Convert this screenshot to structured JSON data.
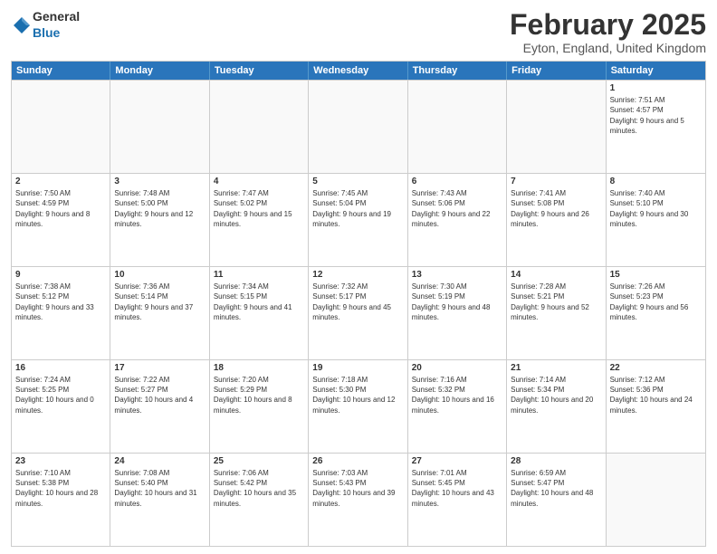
{
  "logo": {
    "general": "General",
    "blue": "Blue"
  },
  "title": "February 2025",
  "location": "Eyton, England, United Kingdom",
  "header_days": [
    "Sunday",
    "Monday",
    "Tuesday",
    "Wednesday",
    "Thursday",
    "Friday",
    "Saturday"
  ],
  "weeks": [
    [
      {
        "day": "",
        "info": ""
      },
      {
        "day": "",
        "info": ""
      },
      {
        "day": "",
        "info": ""
      },
      {
        "day": "",
        "info": ""
      },
      {
        "day": "",
        "info": ""
      },
      {
        "day": "",
        "info": ""
      },
      {
        "day": "1",
        "info": "Sunrise: 7:51 AM\nSunset: 4:57 PM\nDaylight: 9 hours and 5 minutes."
      }
    ],
    [
      {
        "day": "2",
        "info": "Sunrise: 7:50 AM\nSunset: 4:59 PM\nDaylight: 9 hours and 8 minutes."
      },
      {
        "day": "3",
        "info": "Sunrise: 7:48 AM\nSunset: 5:00 PM\nDaylight: 9 hours and 12 minutes."
      },
      {
        "day": "4",
        "info": "Sunrise: 7:47 AM\nSunset: 5:02 PM\nDaylight: 9 hours and 15 minutes."
      },
      {
        "day": "5",
        "info": "Sunrise: 7:45 AM\nSunset: 5:04 PM\nDaylight: 9 hours and 19 minutes."
      },
      {
        "day": "6",
        "info": "Sunrise: 7:43 AM\nSunset: 5:06 PM\nDaylight: 9 hours and 22 minutes."
      },
      {
        "day": "7",
        "info": "Sunrise: 7:41 AM\nSunset: 5:08 PM\nDaylight: 9 hours and 26 minutes."
      },
      {
        "day": "8",
        "info": "Sunrise: 7:40 AM\nSunset: 5:10 PM\nDaylight: 9 hours and 30 minutes."
      }
    ],
    [
      {
        "day": "9",
        "info": "Sunrise: 7:38 AM\nSunset: 5:12 PM\nDaylight: 9 hours and 33 minutes."
      },
      {
        "day": "10",
        "info": "Sunrise: 7:36 AM\nSunset: 5:14 PM\nDaylight: 9 hours and 37 minutes."
      },
      {
        "day": "11",
        "info": "Sunrise: 7:34 AM\nSunset: 5:15 PM\nDaylight: 9 hours and 41 minutes."
      },
      {
        "day": "12",
        "info": "Sunrise: 7:32 AM\nSunset: 5:17 PM\nDaylight: 9 hours and 45 minutes."
      },
      {
        "day": "13",
        "info": "Sunrise: 7:30 AM\nSunset: 5:19 PM\nDaylight: 9 hours and 48 minutes."
      },
      {
        "day": "14",
        "info": "Sunrise: 7:28 AM\nSunset: 5:21 PM\nDaylight: 9 hours and 52 minutes."
      },
      {
        "day": "15",
        "info": "Sunrise: 7:26 AM\nSunset: 5:23 PM\nDaylight: 9 hours and 56 minutes."
      }
    ],
    [
      {
        "day": "16",
        "info": "Sunrise: 7:24 AM\nSunset: 5:25 PM\nDaylight: 10 hours and 0 minutes."
      },
      {
        "day": "17",
        "info": "Sunrise: 7:22 AM\nSunset: 5:27 PM\nDaylight: 10 hours and 4 minutes."
      },
      {
        "day": "18",
        "info": "Sunrise: 7:20 AM\nSunset: 5:29 PM\nDaylight: 10 hours and 8 minutes."
      },
      {
        "day": "19",
        "info": "Sunrise: 7:18 AM\nSunset: 5:30 PM\nDaylight: 10 hours and 12 minutes."
      },
      {
        "day": "20",
        "info": "Sunrise: 7:16 AM\nSunset: 5:32 PM\nDaylight: 10 hours and 16 minutes."
      },
      {
        "day": "21",
        "info": "Sunrise: 7:14 AM\nSunset: 5:34 PM\nDaylight: 10 hours and 20 minutes."
      },
      {
        "day": "22",
        "info": "Sunrise: 7:12 AM\nSunset: 5:36 PM\nDaylight: 10 hours and 24 minutes."
      }
    ],
    [
      {
        "day": "23",
        "info": "Sunrise: 7:10 AM\nSunset: 5:38 PM\nDaylight: 10 hours and 28 minutes."
      },
      {
        "day": "24",
        "info": "Sunrise: 7:08 AM\nSunset: 5:40 PM\nDaylight: 10 hours and 31 minutes."
      },
      {
        "day": "25",
        "info": "Sunrise: 7:06 AM\nSunset: 5:42 PM\nDaylight: 10 hours and 35 minutes."
      },
      {
        "day": "26",
        "info": "Sunrise: 7:03 AM\nSunset: 5:43 PM\nDaylight: 10 hours and 39 minutes."
      },
      {
        "day": "27",
        "info": "Sunrise: 7:01 AM\nSunset: 5:45 PM\nDaylight: 10 hours and 43 minutes."
      },
      {
        "day": "28",
        "info": "Sunrise: 6:59 AM\nSunset: 5:47 PM\nDaylight: 10 hours and 48 minutes."
      },
      {
        "day": "",
        "info": ""
      }
    ]
  ]
}
